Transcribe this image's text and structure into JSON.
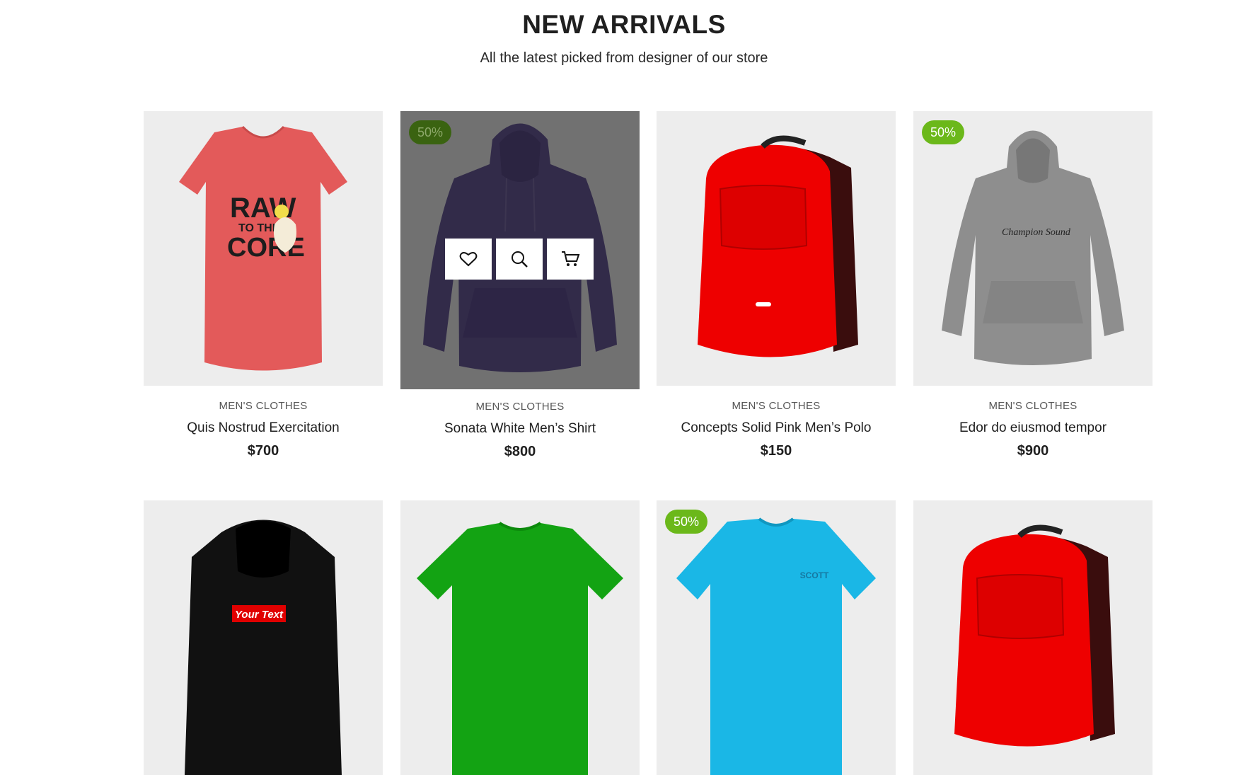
{
  "section": {
    "title": "NEW ARRIVALS",
    "subtitle": "All the latest picked from designer of our store"
  },
  "products": [
    {
      "category": "MEN'S CLOTHES",
      "name": "Quis Nostrud Exercitation",
      "price": "$700",
      "badge": "",
      "image": "red-tshirt"
    },
    {
      "category": "MEN'S CLOTHES",
      "name": "Sonata White Men’s Shirt",
      "price": "$800",
      "badge": "50%",
      "image": "purple-hoodie",
      "hovered": true
    },
    {
      "category": "MEN'S CLOTHES",
      "name": "Concepts Solid Pink Men’s Polo",
      "price": "$150",
      "badge": "",
      "image": "red-backpack"
    },
    {
      "category": "MEN'S CLOTHES",
      "name": "Edor do eiusmod tempor",
      "price": "$900",
      "badge": "50%",
      "image": "grey-hoodie"
    },
    {
      "badge": "",
      "image": "black-hoodie"
    },
    {
      "badge": "",
      "image": "green-tshirt"
    },
    {
      "badge": "50%",
      "image": "blue-tshirt"
    },
    {
      "badge": "",
      "image": "red-backpack"
    }
  ],
  "image_text": {
    "tshirt_print_1": "RAW",
    "tshirt_print_2": "TO THE",
    "tshirt_print_3": "CORE",
    "hoodie_print": "Champion Sound",
    "black_hoodie_print": "Your Text",
    "blue_tee_print": "SCOTT"
  },
  "actions": {
    "wishlist": "heart-icon",
    "quick_view": "search-icon",
    "add_to_cart": "cart-icon"
  },
  "colors": {
    "badge": "#6bb81a",
    "thumb_bg": "#ededed"
  }
}
